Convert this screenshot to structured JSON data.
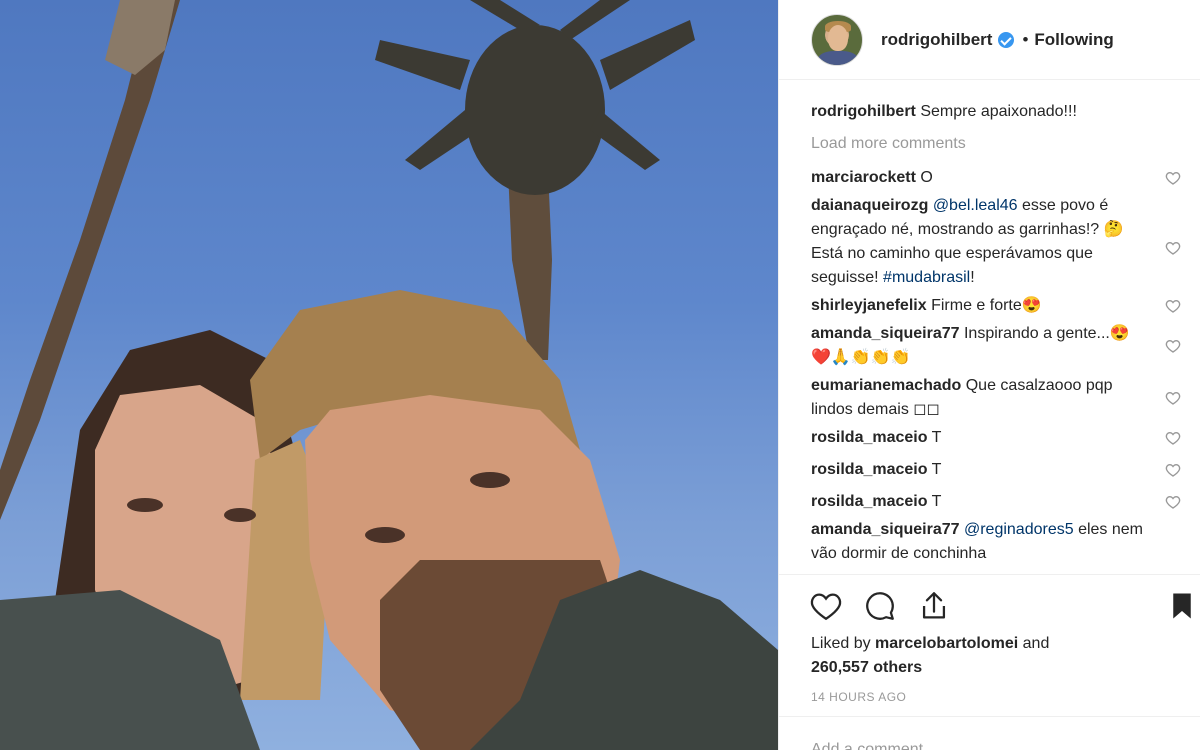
{
  "post": {
    "username": "rodrigohilbert",
    "dot": "•",
    "follow_status": "Following",
    "caption": "Sempre apaixonado!!!",
    "load_more": "Load more comments",
    "liked_by_prefix": "Liked by",
    "liked_by_user": "marcelobartolomei",
    "liked_by_and": "and",
    "likes_count": "260,557 others",
    "timestamp": "14 HOURS AGO",
    "add_comment_placeholder": "Add a comment..."
  },
  "comments": [
    {
      "user": "marciarockett",
      "text": "O"
    },
    {
      "user": "daianaqueirozg",
      "mention": "@bel.leal46",
      "text": "esse povo é engraçado né, mostrando as garrinhas!? 🤔 Está no caminho que esperávamos que seguisse!",
      "hashtag": "#mudabrasil",
      "tail": "!"
    },
    {
      "user": "shirleyjanefelix",
      "text": "Firme e forte😍"
    },
    {
      "user": "amanda_siqueira77",
      "text": "Inspirando a gente...😍❤️🙏👏👏👏"
    },
    {
      "user": "eumarianemachado",
      "text": "Que casalzaooo pqp lindos demais ◻◻"
    },
    {
      "user": "rosilda_maceio",
      "text": "T"
    },
    {
      "user": "rosilda_maceio",
      "text": "T"
    },
    {
      "user": "rosilda_maceio",
      "text": "T"
    },
    {
      "user": "amanda_siqueira77",
      "mention": "@reginadores5",
      "text": "eles nem vão dormir de conchinha"
    }
  ],
  "icons": {
    "verified": "verified-badge-icon",
    "heart": "heart-icon",
    "comment": "comment-bubble-icon",
    "share": "share-icon",
    "bookmark": "bookmark-icon"
  },
  "colors": {
    "verified_blue": "#3897f0",
    "mention": "#003569",
    "muted": "#999999",
    "text": "#262626"
  }
}
